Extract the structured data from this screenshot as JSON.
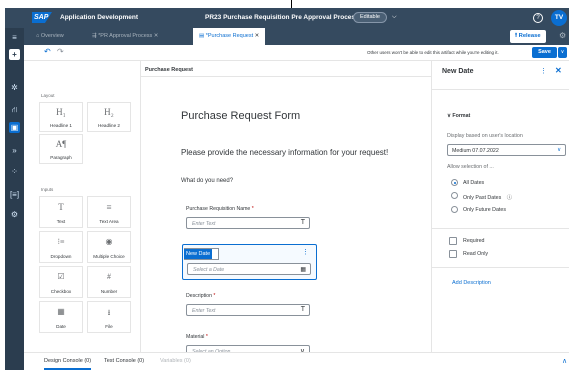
{
  "shell": {
    "logo": "SAP",
    "app_title": "Application Development",
    "process_title": "PR23 Purchase Requisition Pre Approval Process",
    "editable_badge": "Editable",
    "avatar": "TV",
    "colors": {
      "header": "#354a5f",
      "accent": "#0a6ed1"
    }
  },
  "rail_icons": [
    "menu-icon",
    "add-icon",
    "lightbulb-icon",
    "flow-icon",
    "content-icon",
    "forward-icon",
    "grid-icon",
    "bracket-icon",
    "gear-icon"
  ],
  "tabs": [
    {
      "label": "Overview",
      "icon": "home-icon"
    },
    {
      "label": "*PR Approval Process",
      "icon": "process-icon"
    },
    {
      "label": "*Purchase Request",
      "icon": "form-icon",
      "active": true
    }
  ],
  "toolbar": {
    "release_label": "Release",
    "edit_note": "Other users won't be able to edit this artifact while you're editing it.",
    "save_label": "Save"
  },
  "palette": {
    "layout_label": "Layout",
    "layout_items": [
      {
        "glyph": "H₁",
        "label": "Headline 1"
      },
      {
        "glyph": "H₂",
        "label": "Headline 2"
      },
      {
        "glyph": "A¶",
        "label": "Paragraph"
      }
    ],
    "inputs_label": "Inputs",
    "input_items": [
      {
        "glyph": "T",
        "label": "Text"
      },
      {
        "glyph": "≡",
        "label": "Text Area"
      },
      {
        "glyph": "⁝≡",
        "label": "Dropdown"
      },
      {
        "glyph": "◉",
        "label": "Multiple Choice"
      },
      {
        "glyph": "☑",
        "label": "Checkbox"
      },
      {
        "glyph": "#",
        "label": "Number"
      },
      {
        "glyph": "▦",
        "label": "Date"
      },
      {
        "glyph": "⭳",
        "label": "File"
      }
    ]
  },
  "canvas": {
    "header": "Purchase Request",
    "title": "Purchase Request Form",
    "intro": "Please provide the necessary information for your request!",
    "question": "What do you need?",
    "fields": [
      {
        "label": "Purchase Requisition Name",
        "required": "*",
        "placeholder": "Enter Text",
        "icon": "T"
      },
      {
        "label": "Description",
        "required": "*",
        "placeholder": "Enter Text",
        "icon": "T"
      },
      {
        "label": "Material",
        "required": "*",
        "placeholder": "Select an Option",
        "icon": "∨"
      }
    ],
    "selected_field": {
      "label": "New Date",
      "placeholder": "Select a Date",
      "icon": "calendar-icon"
    }
  },
  "properties": {
    "title": "New Date",
    "section": "Format",
    "display_label": "Display based on user's location",
    "format_value": "Medium 07.07.2022",
    "allow_label": "Allow selection of ...",
    "options": [
      {
        "label": "All Dates",
        "selected": true
      },
      {
        "label": "Only Past Dates",
        "selected": false,
        "info": "ⓘ"
      },
      {
        "label": "Only Future Dates",
        "selected": false
      }
    ],
    "checks": [
      {
        "label": "Required",
        "checked": false
      },
      {
        "label": "Read Only",
        "checked": false
      }
    ],
    "add_description": "Add Description"
  },
  "console": {
    "tabs": [
      {
        "label": "Design Console (0)",
        "active": true
      },
      {
        "label": "Test Console (0)"
      },
      {
        "label": "Variables (0)",
        "disabled": true
      }
    ]
  }
}
